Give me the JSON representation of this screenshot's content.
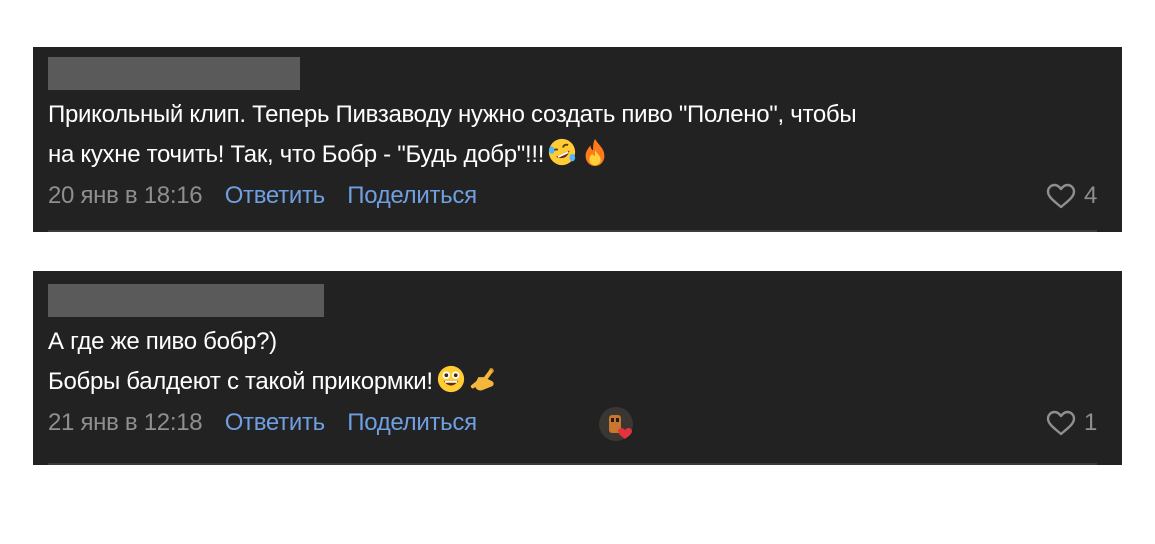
{
  "comments": [
    {
      "author_name": "",
      "lines": [
        "Прикольный клип. Теперь Пивзаводу нужно создать пиво \"Полено\", чтобы",
        "на кухне точить! Так, что Бобр - \"Будь добр\"!!!"
      ],
      "emojis": [
        "rolling-on-floor-laughing-emoji",
        "fire-emoji"
      ],
      "timestamp": "20 янв в 18:16",
      "reply_label": "Ответить",
      "share_label": "Поделиться",
      "like_count": "4"
    },
    {
      "author_name": "",
      "lines": [
        "А где же пиво бобр?)",
        "Бобры балдеют с такой прикормки!"
      ],
      "emojis": [
        "grinning-face-emoji",
        "call-me-hand-emoji"
      ],
      "timestamp": "21 янв в 12:18",
      "reply_label": "Ответить",
      "share_label": "Поделиться",
      "like_count": "1",
      "reaction": "author-liked-avatar"
    }
  ],
  "colors": {
    "card_background": "#222222",
    "text": "#ffffff",
    "muted": "#8f8f8f",
    "link": "#6f9fe0",
    "heart": "#e5323c"
  }
}
